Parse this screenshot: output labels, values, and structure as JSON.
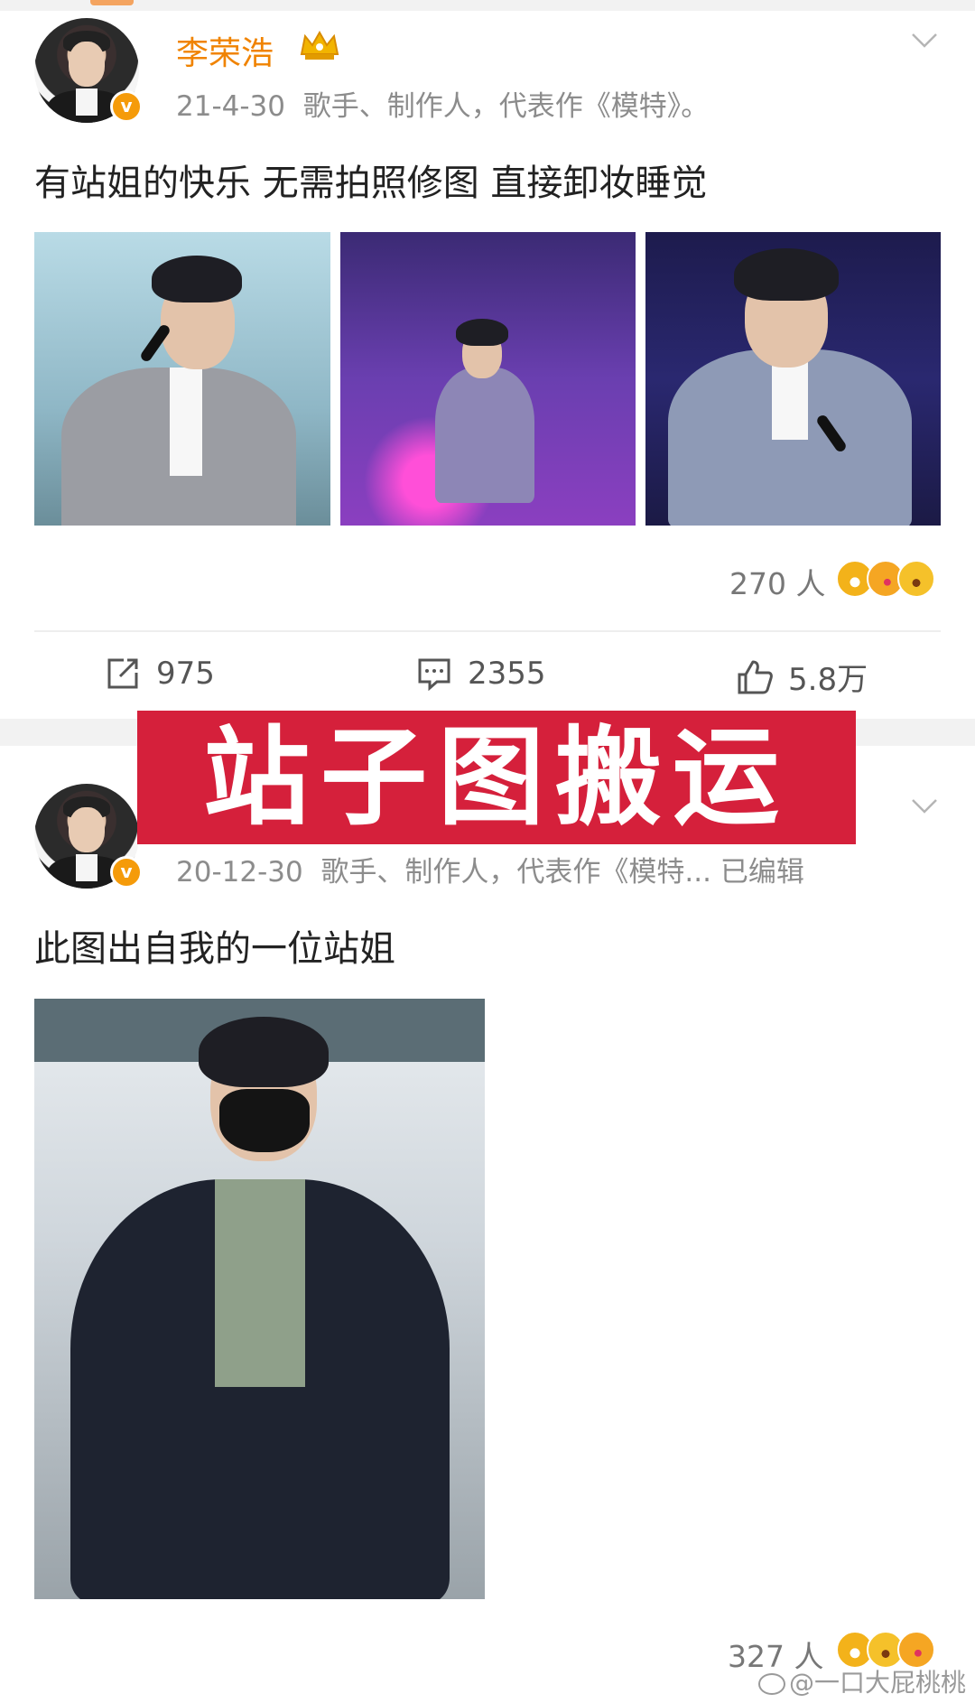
{
  "posts": [
    {
      "username": "李荣浩",
      "date": "21-4-30",
      "bio": "歌手、制作人，代表作《模特》。",
      "text": "有站姐的快乐 无需拍照修图 直接卸妆睡觉",
      "reaction_count": "270 人",
      "reactions": [
        "laugh-emoji",
        "kiss-emoji",
        "wow-emoji"
      ],
      "actions": {
        "repost": "975",
        "comment": "2355",
        "like": "5.8万"
      }
    },
    {
      "date": "20-12-30",
      "bio": "歌手、制作人，代表作《模特...",
      "edited": "已编辑",
      "text": "此图出自我的一位站姐",
      "reaction_count": "327 人",
      "reactions": [
        "laugh-emoji",
        "wow-emoji",
        "kiss-emoji"
      ]
    }
  ],
  "banner": "站子图搬运",
  "watermark": "@一口大屁桃桃",
  "colors": {
    "username": "#f08300",
    "banner": "#d5203b",
    "vbadge": "#f59b0a"
  }
}
